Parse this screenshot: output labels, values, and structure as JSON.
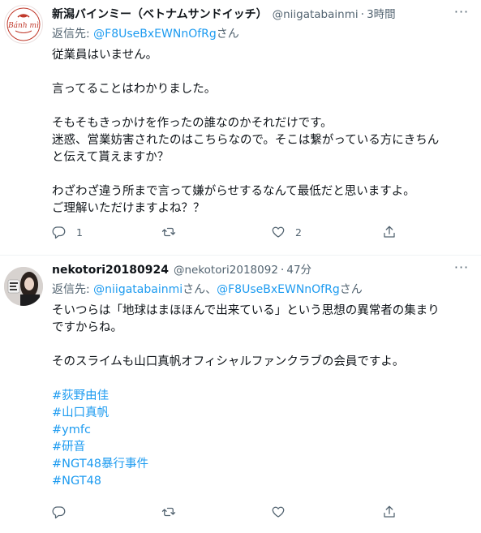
{
  "tweets": [
    {
      "name": "新潟バインミー（ベトナムサンドイッチ）",
      "handle": "@niigatabainmi",
      "time": "3時間",
      "reply_prefix": "返信先: ",
      "reply_mentions": [
        "@F8UseBxEWNnOfRg"
      ],
      "reply_suffix": "さん",
      "avatar_logo_text": "Bánh mì",
      "lines": [
        "従業員はいません。",
        "",
        "言ってることはわかりました。",
        "",
        "そもそもきっかけを作ったの誰なのかそれだけです。",
        "迷惑、営業妨害されたのはこちらなので。そこは繋がっている方にきちん",
        "と伝えて貰えますか？",
        "",
        "わざわざ違う所まで言って嫌がらせするなんて最低だと思いますよ。",
        "ご理解いただけますよね？？"
      ],
      "hashtags": [],
      "actions": {
        "reply_count": "1",
        "retweet_count": "",
        "like_count": "2"
      }
    },
    {
      "name": "nekotori20180924",
      "handle": "@nekotori2018092",
      "time": "47分",
      "reply_prefix": "返信先: ",
      "reply_mentions": [
        "@niigatabainmi",
        "@F8UseBxEWNnOfRg"
      ],
      "reply_mid": "さん、",
      "reply_suffix": "さん",
      "lines": [
        "そいつらは「地球はまほほんで出来ている」という思想の異常者の集まり",
        "ですからね。",
        "",
        "そのスライムも山口真帆オフィシャルファンクラブの会員ですよ。",
        ""
      ],
      "hashtags": [
        "#荻野由佳",
        "#山口真帆",
        "#ymfc",
        "#研音",
        "#NGT48暴行事件",
        "#NGT48"
      ],
      "actions": {
        "reply_count": "",
        "retweet_count": "",
        "like_count": ""
      }
    }
  ],
  "more_label": "···",
  "dot": "·",
  "colors": {
    "link": "#1d9bf0",
    "secondary": "#536471",
    "text": "#0f1419",
    "divider": "#eff3f4"
  },
  "icons": [
    "reply-icon",
    "retweet-icon",
    "like-icon",
    "share-icon",
    "more-icon"
  ]
}
